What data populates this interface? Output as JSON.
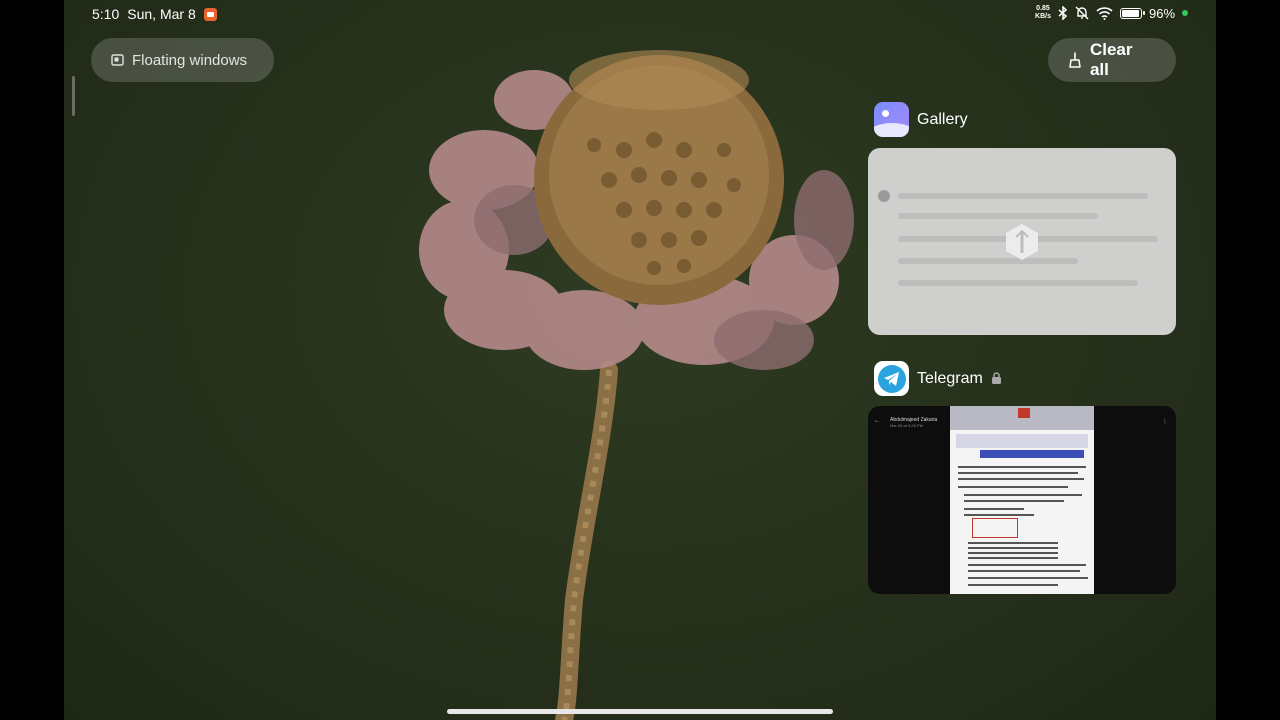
{
  "status_bar": {
    "time": "5:10",
    "date": "Sun, Mar 8",
    "net_speed_value": "0.85",
    "net_speed_unit": "KB/s",
    "battery_percent": "96",
    "battery_symbol": "%"
  },
  "floating_windows_label": "Floating windows",
  "clear_all_label": "Clear all",
  "recent_apps": [
    {
      "name": "Gallery",
      "locked": false
    },
    {
      "name": "Telegram",
      "locked": true
    }
  ],
  "telegram_preview": {
    "sender": "Abdulmajeed Zakaria",
    "subtitle": "Mar 08 at 5:26 PM"
  },
  "colors": {
    "accent_green": "#34c759",
    "record_orange": "#e8642c",
    "telegram_blue": "#2aa3df"
  }
}
